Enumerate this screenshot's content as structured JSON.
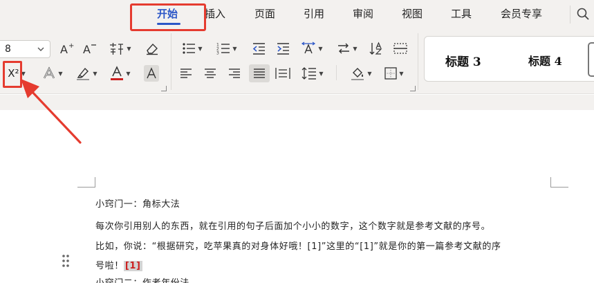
{
  "tabs": [
    {
      "label": "开始",
      "active": true
    },
    {
      "label": "插入"
    },
    {
      "label": "页面"
    },
    {
      "label": "引用"
    },
    {
      "label": "审阅"
    },
    {
      "label": "视图"
    },
    {
      "label": "工具"
    },
    {
      "label": "会员专享"
    }
  ],
  "ribbon": {
    "font_size": "8",
    "superscript_label": "X²",
    "styles": [
      "标题 3",
      "标题 4"
    ]
  },
  "document": {
    "lines": [
      "小窍门一：角标大法",
      "每次你引用别人的东西，就在引用的句子后面加个小小的数字，这个数字就是参考文献的序号。",
      "比如，你说：“根据研究，吃苹果真的对身体好哦！[1]”这里的“[1]”就是你的第一篇参考文献的序",
      "号啦！",
      "小窍门二：作者年份法"
    ],
    "ref_marker": "[1]"
  },
  "colors": {
    "accent": "#2b56c7",
    "annotation": "#e53b2f",
    "font_color": "#cc1f1f"
  }
}
